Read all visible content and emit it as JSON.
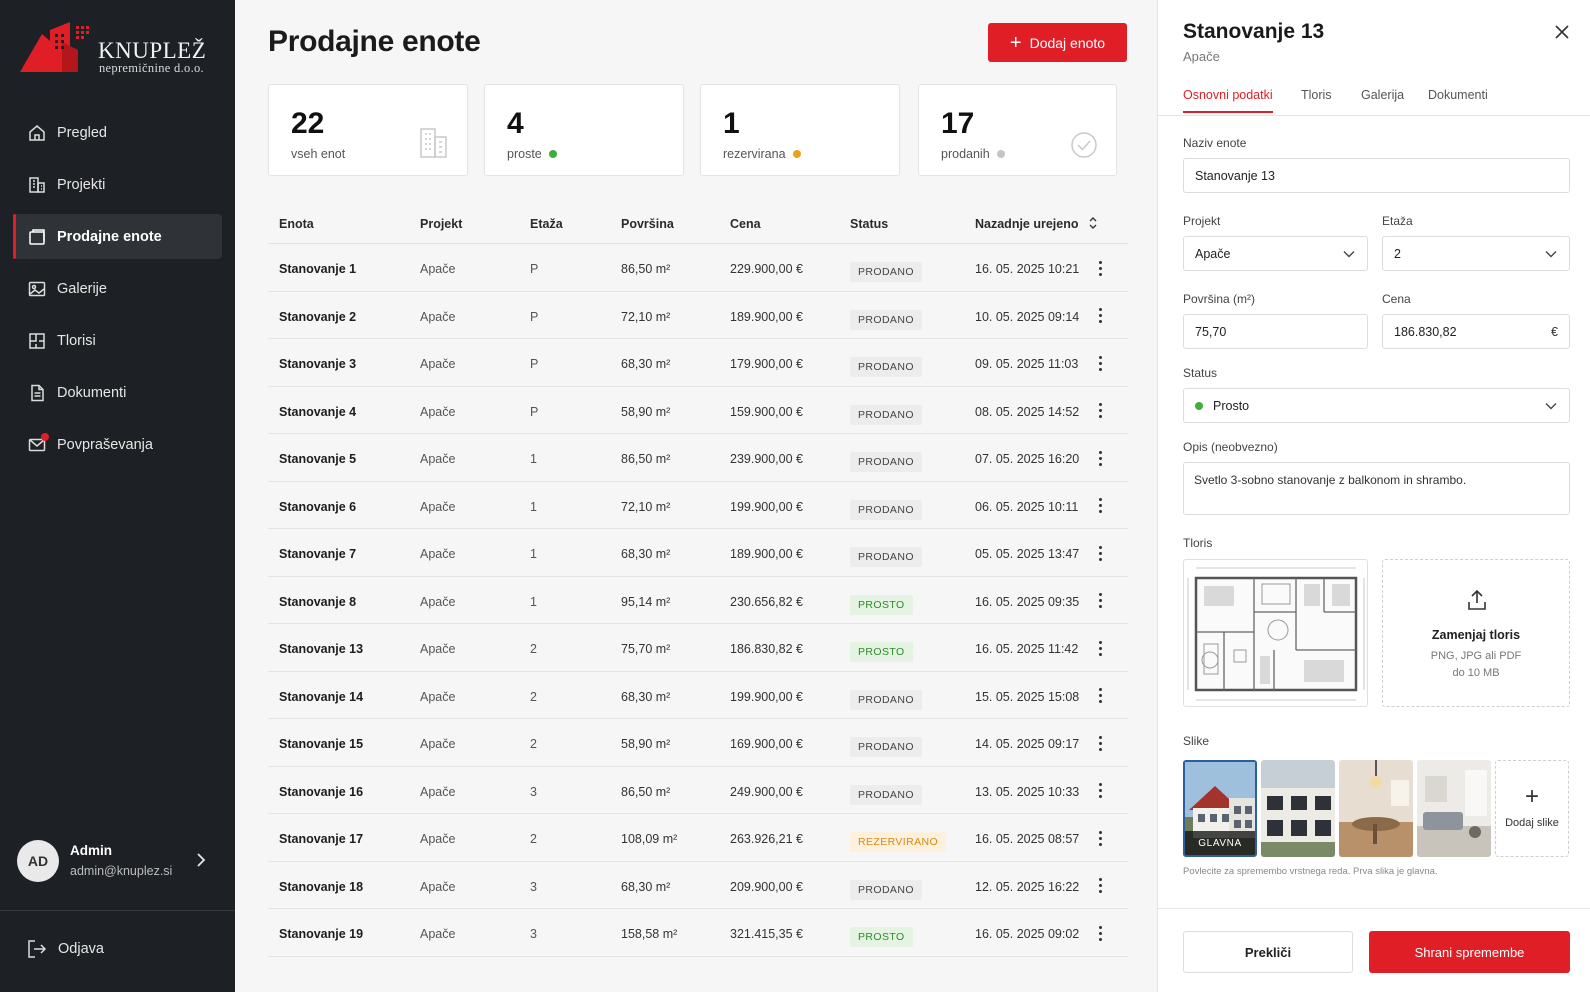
{
  "brand": {
    "name": "KNUPLEŽ",
    "sub": "nepremičnine d.o.o.",
    "accent": "#e01e26"
  },
  "sidebar": {
    "items": [
      {
        "label": "Pregled",
        "icon": "home-icon"
      },
      {
        "label": "Projekti",
        "icon": "building-icon"
      },
      {
        "label": "Prodajne enote",
        "icon": "units-icon",
        "active": true
      },
      {
        "label": "Galerije",
        "icon": "image-icon"
      },
      {
        "label": "Tlorisi",
        "icon": "floorplan-icon"
      },
      {
        "label": "Dokumenti",
        "icon": "document-icon"
      },
      {
        "label": "Povpraševanja",
        "icon": "mail-icon",
        "notification": true
      }
    ],
    "user": {
      "initials": "AD",
      "name": "Admin",
      "email": "admin@knuplez.si"
    },
    "logout": "Odjava"
  },
  "main": {
    "title": "Prodajne enote",
    "add_button": "Dodaj enoto",
    "stats": [
      {
        "value": "22",
        "label": "vseh enot"
      },
      {
        "value": "4",
        "label": "proste",
        "dot": "#3fae3b"
      },
      {
        "value": "1",
        "label": "rezervirana",
        "dot": "#e9a21a"
      },
      {
        "value": "17",
        "label": "prodanih",
        "dot": "#c4c4c4"
      }
    ],
    "columns": [
      "Enota",
      "Projekt",
      "Etaža",
      "Površina",
      "Cena",
      "Status",
      "Nazadnje urejeno"
    ],
    "rows": [
      {
        "unit": "Stanovanje 1",
        "project": "Apače",
        "floor": "P",
        "area": "86,50 m²",
        "price": "229.900,00 €",
        "status": "PRODANO",
        "updated": "16. 05. 2025 10:21"
      },
      {
        "unit": "Stanovanje 2",
        "project": "Apače",
        "floor": "P",
        "area": "72,10 m²",
        "price": "189.900,00 €",
        "status": "PRODANO",
        "updated": "10. 05. 2025 09:14"
      },
      {
        "unit": "Stanovanje 3",
        "project": "Apače",
        "floor": "P",
        "area": "68,30 m²",
        "price": "179.900,00 €",
        "status": "PRODANO",
        "updated": "09. 05. 2025 11:03"
      },
      {
        "unit": "Stanovanje 4",
        "project": "Apače",
        "floor": "P",
        "area": "58,90 m²",
        "price": "159.900,00 €",
        "status": "PRODANO",
        "updated": "08. 05. 2025 14:52"
      },
      {
        "unit": "Stanovanje 5",
        "project": "Apače",
        "floor": "1",
        "area": "86,50 m²",
        "price": "239.900,00 €",
        "status": "PRODANO",
        "updated": "07. 05. 2025 16:20"
      },
      {
        "unit": "Stanovanje 6",
        "project": "Apače",
        "floor": "1",
        "area": "72,10 m²",
        "price": "199.900,00 €",
        "status": "PRODANO",
        "updated": "06. 05. 2025 10:11"
      },
      {
        "unit": "Stanovanje 7",
        "project": "Apače",
        "floor": "1",
        "area": "68,30 m²",
        "price": "189.900,00 €",
        "status": "PRODANO",
        "updated": "05. 05. 2025 13:47"
      },
      {
        "unit": "Stanovanje 8",
        "project": "Apače",
        "floor": "1",
        "area": "95,14 m²",
        "price": "230.656,82 €",
        "status": "PROSTO",
        "updated": "16. 05. 2025 09:35"
      },
      {
        "unit": "Stanovanje 13",
        "project": "Apače",
        "floor": "2",
        "area": "75,70 m²",
        "price": "186.830,82 €",
        "status": "PROSTO",
        "updated": "16. 05. 2025 11:42"
      },
      {
        "unit": "Stanovanje 14",
        "project": "Apače",
        "floor": "2",
        "area": "68,30 m²",
        "price": "199.900,00 €",
        "status": "PRODANO",
        "updated": "15. 05. 2025 15:08"
      },
      {
        "unit": "Stanovanje 15",
        "project": "Apače",
        "floor": "2",
        "area": "58,90 m²",
        "price": "169.900,00 €",
        "status": "PRODANO",
        "updated": "14. 05. 2025 09:17"
      },
      {
        "unit": "Stanovanje 16",
        "project": "Apače",
        "floor": "3",
        "area": "86,50 m²",
        "price": "249.900,00 €",
        "status": "PRODANO",
        "updated": "13. 05. 2025 10:33"
      },
      {
        "unit": "Stanovanje 17",
        "project": "Apače",
        "floor": "2",
        "area": "108,09 m²",
        "price": "263.926,21 €",
        "status": "REZERVIRANO",
        "updated": "16. 05. 2025 08:57"
      },
      {
        "unit": "Stanovanje 18",
        "project": "Apače",
        "floor": "3",
        "area": "68,30 m²",
        "price": "209.900,00 €",
        "status": "PRODANO",
        "updated": "12. 05. 2025 16:22"
      },
      {
        "unit": "Stanovanje 19",
        "project": "Apače",
        "floor": "3",
        "area": "158,58 m²",
        "price": "321.415,35 €",
        "status": "PROSTO",
        "updated": "16. 05. 2025 09:02"
      }
    ]
  },
  "panel": {
    "title": "Stanovanje 13",
    "subtitle": "Apače",
    "tabs": [
      "Osnovni podatki",
      "Tloris",
      "Galerija",
      "Dokumenti"
    ],
    "fields": {
      "name_label": "Naziv enote",
      "name_value": "Stanovanje 13",
      "project_label": "Projekt",
      "project_value": "Apače",
      "floor_label": "Etaža",
      "floor_value": "2",
      "area_label": "Površina (m²)",
      "area_value": "75,70",
      "price_label": "Cena",
      "price_value": "186.830,82",
      "price_suffix": "€",
      "status_label": "Status",
      "status_value": "Prosto",
      "desc_label": "Opis (neobvezno)",
      "desc_value": "Svetlo 3-sobno stanovanje z balkonom in shrambo."
    },
    "plan": {
      "label": "Tloris",
      "replace_title": "Zamenjaj tloris",
      "replace_formats": "PNG, JPG ali PDF",
      "replace_size": "do 10 MB"
    },
    "images": {
      "label": "Slike",
      "main_badge": "GLAVNA",
      "add_label": "Dodaj slike",
      "hint": "Povlecite za spremembo vrstnega reda. Prva slika je glavna."
    },
    "cancel": "Prekliči",
    "save": "Shrani spremembe"
  }
}
